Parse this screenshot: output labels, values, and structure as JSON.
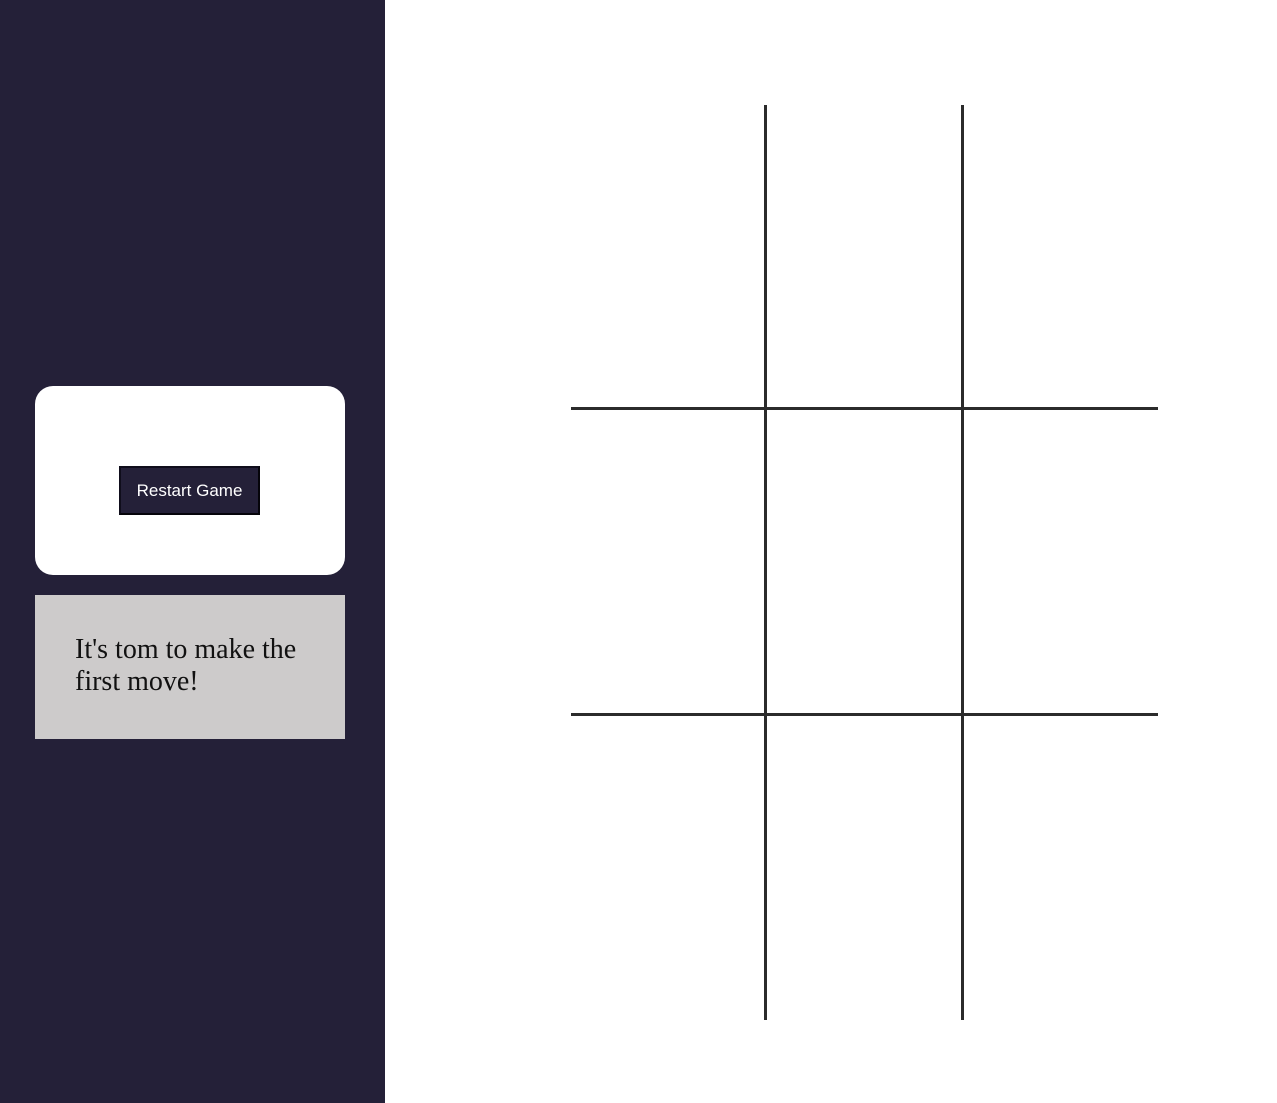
{
  "controls": {
    "restart_label": "Restart Game"
  },
  "status": {
    "message": "It's tom to make the first move!"
  },
  "board": {
    "cells": [
      "",
      "",
      "",
      "",
      "",
      "",
      "",
      "",
      ""
    ]
  },
  "colors": {
    "sidebar": "#242038",
    "card": "#ffffff",
    "message_box": "#cdcbcb",
    "grid_line": "#2b2b2b",
    "button": "#242038",
    "button_text": "#ffffff"
  }
}
